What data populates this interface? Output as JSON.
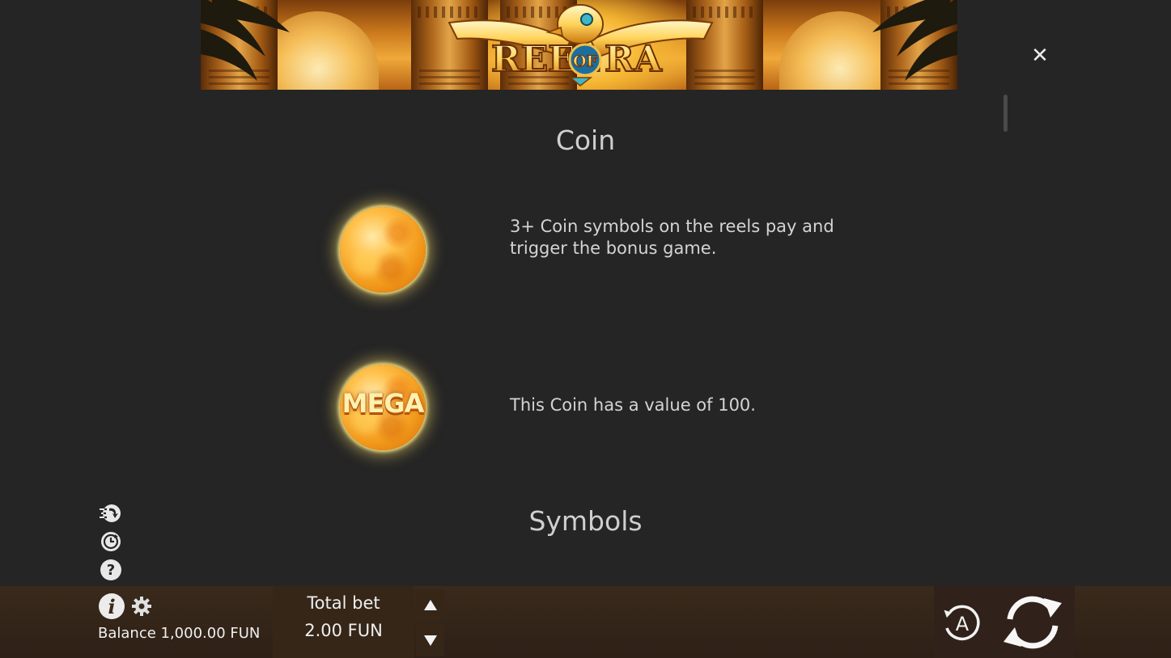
{
  "banner": {
    "logo_text_left": "REEL",
    "logo_text_mid": "OF",
    "logo_text_right": "RA"
  },
  "close_label": "✕",
  "sections": {
    "coin_title": "Coin",
    "symbols_title": "Symbols"
  },
  "coins": {
    "regular_description": "3+ Coin symbols on the reels pay and trigger the bonus game.",
    "mega_label": "MEGA",
    "mega_description": "This Coin has a value of 100."
  },
  "bottom_bar": {
    "balance_text": "Balance 1,000.00 FUN",
    "total_bet_label": "Total bet",
    "total_bet_value": "2.00 FUN"
  },
  "icons": {
    "close": "close-icon",
    "fast_spin": "fast-spin-icon",
    "history": "history-icon",
    "help": "help-icon",
    "info": "info-icon",
    "settings": "gear-icon",
    "bet_up": "triangle-up-icon",
    "bet_down": "triangle-down-icon",
    "autoplay": "autoplay-icon",
    "spin": "spin-icon"
  },
  "colors": {
    "background": "#252525",
    "text": "#d4d4d4",
    "bottom_bar": "#3a2a1c",
    "coin_orange": "#f29a1c",
    "coin_glow": "#ffe16e"
  }
}
